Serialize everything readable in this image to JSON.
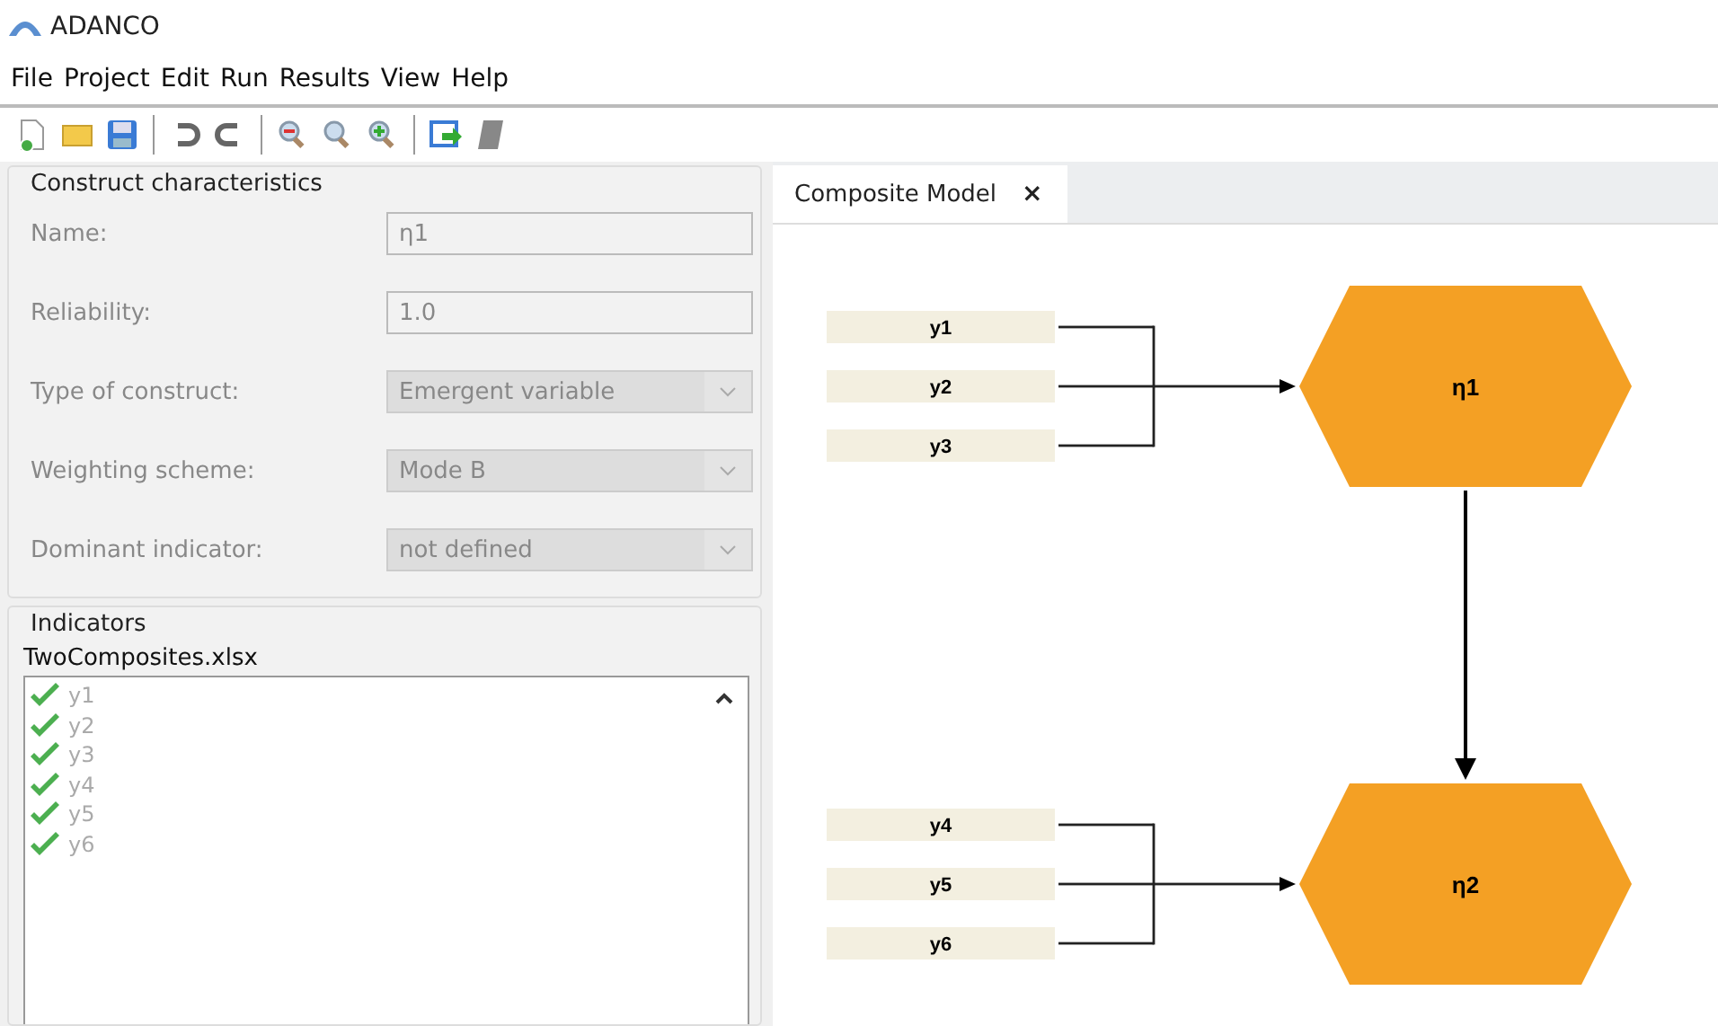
{
  "window": {
    "title": "ADANCO"
  },
  "menu": [
    "File",
    "Project",
    "Edit",
    "Run",
    "Results",
    "View",
    "Help"
  ],
  "construct_characteristics": {
    "title": "Construct characteristics",
    "fields": [
      {
        "label": "Name:",
        "kind": "text",
        "value": "η1"
      },
      {
        "label": "Reliability:",
        "kind": "text",
        "value": "1.0"
      },
      {
        "label": "Type of construct:",
        "kind": "select",
        "value": "Emergent variable"
      },
      {
        "label": "Weighting scheme:",
        "kind": "select",
        "value": "Mode B"
      },
      {
        "label": "Dominant indicator:",
        "kind": "select",
        "value": "not defined"
      }
    ]
  },
  "indicators": {
    "title": "Indicators",
    "file": "TwoComposites.xlsx",
    "items": [
      {
        "label": "y1",
        "checked": true
      },
      {
        "label": "y2",
        "checked": true
      },
      {
        "label": "y3",
        "checked": true
      },
      {
        "label": "y4",
        "checked": true
      },
      {
        "label": "y5",
        "checked": true
      },
      {
        "label": "y6",
        "checked": true
      }
    ]
  },
  "tabs": [
    {
      "label": "Composite Model",
      "close": "×",
      "selected": true
    }
  ],
  "model": {
    "constructs": [
      {
        "label": "η1",
        "indicators": [
          "y1",
          "y2",
          "y3"
        ]
      },
      {
        "label": "η2",
        "indicators": [
          "y4",
          "y5",
          "y6"
        ]
      }
    ]
  }
}
